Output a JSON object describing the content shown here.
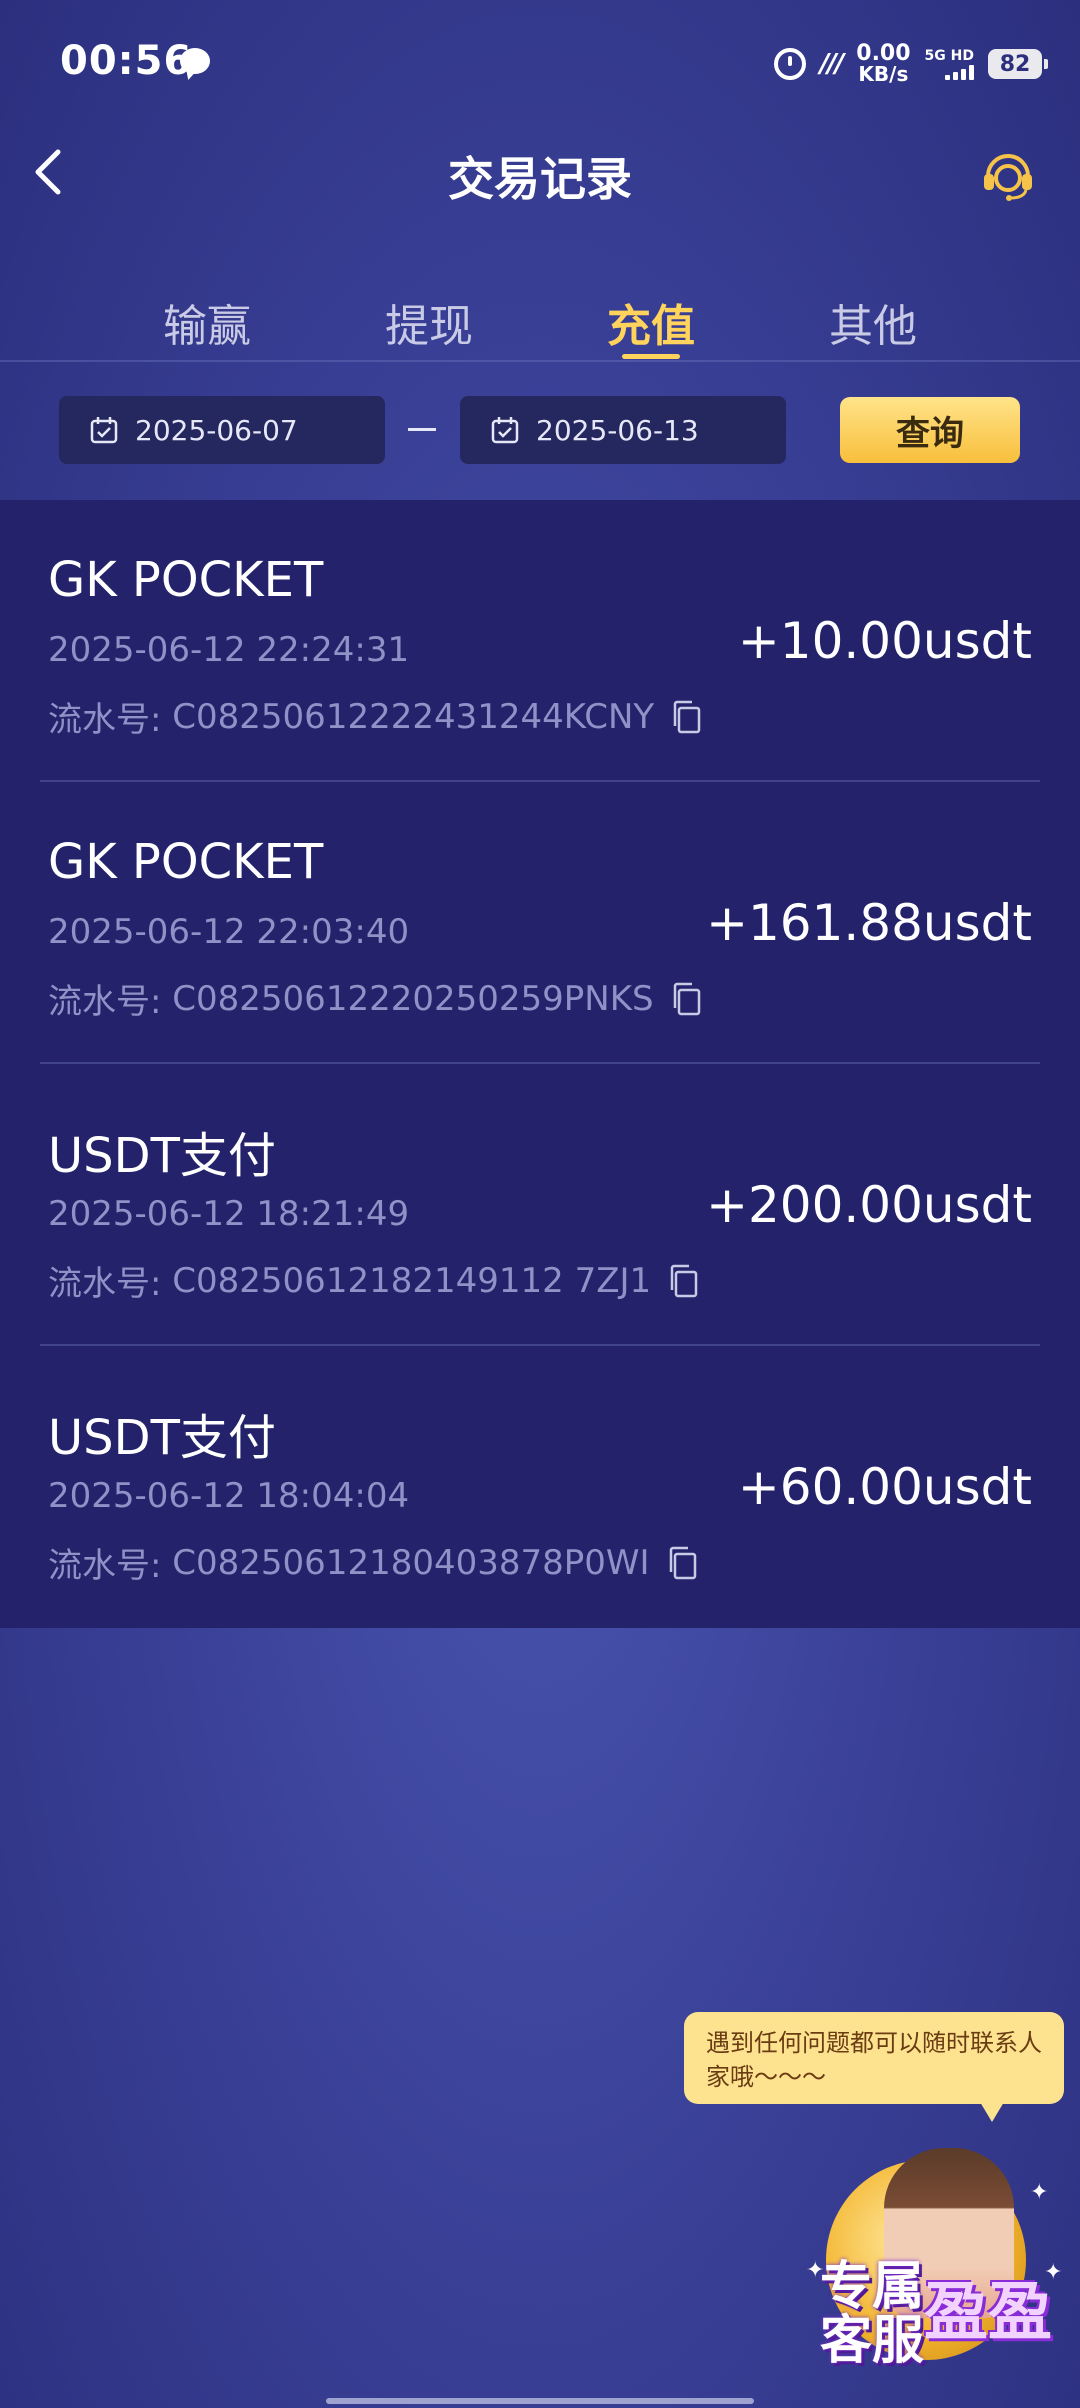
{
  "status_bar": {
    "time": "00:56",
    "net_speed_value": "0.00",
    "net_speed_unit": "KB/s",
    "signal_label": "5G HD",
    "battery": "82"
  },
  "header": {
    "title": "交易记录"
  },
  "tabs": [
    {
      "label": "输赢",
      "active": false
    },
    {
      "label": "提现",
      "active": false
    },
    {
      "label": "充值",
      "active": true
    },
    {
      "label": "其他",
      "active": false
    }
  ],
  "filter": {
    "start_date": "2025-06-07",
    "end_date": "2025-06-13",
    "query_label": "查询"
  },
  "records": [
    {
      "name": "GK POCKET",
      "time": "2025-06-12 22:24:31",
      "serial_label": "流水号:",
      "serial": "C08250612222431244KCNY",
      "amount": "+10.00usdt"
    },
    {
      "name": "GK POCKET",
      "time": "2025-06-12 22:03:40",
      "serial_label": "流水号:",
      "serial": "C08250612220250259PNKS",
      "amount": "+161.88usdt"
    },
    {
      "name": "USDT支付",
      "time": "2025-06-12 18:21:49",
      "serial_label": "流水号:",
      "serial": "C08250612182149112 7ZJ1",
      "amount": "+200.00usdt"
    },
    {
      "name": "USDT支付",
      "time": "2025-06-12 18:04:04",
      "serial_label": "流水号:",
      "serial": "C08250612180403878P0WI",
      "amount": "+60.00usdt"
    }
  ],
  "support": {
    "tooltip": "遇到任何问题都可以随时联系人家哦～～～",
    "badge_line1": "专属",
    "badge_line2": "客服",
    "badge_name": "盈盈"
  },
  "colors": {
    "accent": "#ffd35c",
    "list_bg": "#23226a",
    "secondary_text": "#8e92c7"
  }
}
